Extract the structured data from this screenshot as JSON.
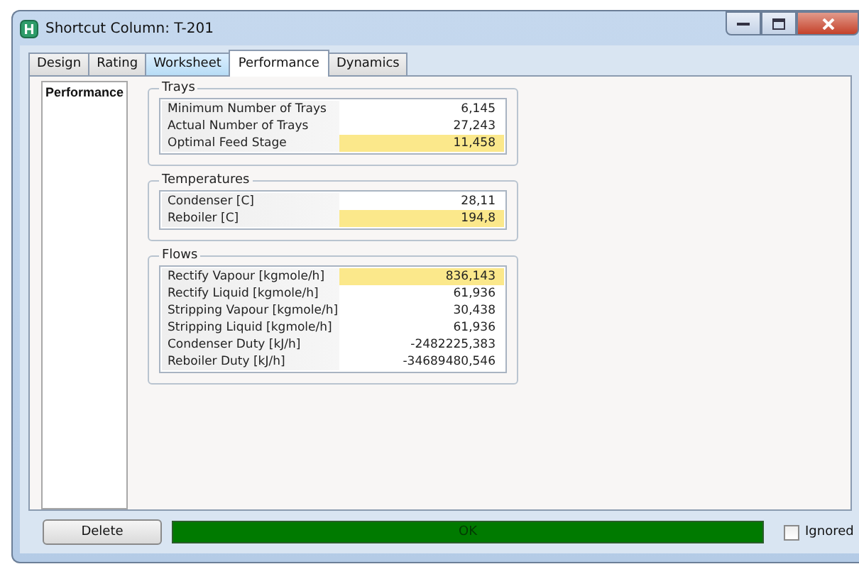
{
  "window": {
    "title": "Shortcut Column: T-201"
  },
  "tabs": [
    {
      "label": "Design",
      "selected": false,
      "highlighted": false
    },
    {
      "label": "Rating",
      "selected": false,
      "highlighted": false
    },
    {
      "label": "Worksheet",
      "selected": false,
      "highlighted": true
    },
    {
      "label": "Performance",
      "selected": true,
      "highlighted": false
    },
    {
      "label": "Dynamics",
      "selected": false,
      "highlighted": false
    }
  ],
  "sidebar": {
    "items": [
      {
        "label": "Performance"
      }
    ]
  },
  "groups": [
    {
      "title": "Trays",
      "rows": [
        {
          "label": "Minimum Number of Trays",
          "value": "6,145",
          "highlighted": false
        },
        {
          "label": "Actual Number of Trays",
          "value": "27,243",
          "highlighted": false
        },
        {
          "label": "Optimal Feed Stage",
          "value": "11,458",
          "highlighted": true
        }
      ]
    },
    {
      "title": "Temperatures",
      "rows": [
        {
          "label": "Condenser [C]",
          "value": "28,11",
          "highlighted": false
        },
        {
          "label": "Reboiler [C]",
          "value": "194,8",
          "highlighted": true
        }
      ]
    },
    {
      "title": "Flows",
      "rows": [
        {
          "label": "Rectify Vapour [kgmole/h]",
          "value": "836,143",
          "highlighted": true
        },
        {
          "label": "Rectify Liquid [kgmole/h]",
          "value": "61,936",
          "highlighted": false
        },
        {
          "label": "Stripping Vapour [kgmole/h]",
          "value": "30,438",
          "highlighted": false
        },
        {
          "label": "Stripping Liquid [kgmole/h]",
          "value": "61,936",
          "highlighted": false
        },
        {
          "label": "Condenser Duty [kJ/h]",
          "value": "-2482225,383",
          "highlighted": false
        },
        {
          "label": "Reboiler Duty [kJ/h]",
          "value": "-34689480,546",
          "highlighted": false
        }
      ]
    }
  ],
  "footer": {
    "delete_button": "Delete",
    "status": {
      "text": "OK",
      "color": "#007a00"
    },
    "ignored": {
      "label": "Ignored",
      "checked": false
    }
  }
}
